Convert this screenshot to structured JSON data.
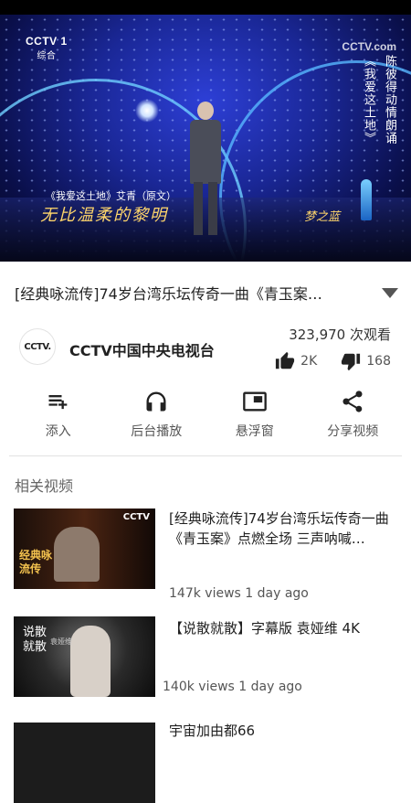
{
  "player": {
    "channel_logo": "CCTV 1",
    "channel_logo_sub": "综合",
    "watermark": "CCTV.com",
    "caption_title": "《我爱这土地》艾青（原文）",
    "caption_main": "无比温柔的黎明",
    "caption_right": "梦之蓝",
    "vertical_lines": [
      "陈彼得动情朗诵",
      "《我爱这土地》"
    ]
  },
  "video": {
    "title": "[经典咏流传]74岁台湾乐坛传奇一曲《青玉案…",
    "views": "323,970 次观看",
    "likes": "2K",
    "dislikes": "168"
  },
  "channel": {
    "avatar_text": "CCTV.",
    "name": "CCTV中国中央电视台"
  },
  "actions": [
    {
      "label": "添入",
      "icon": "playlist-add-icon"
    },
    {
      "label": "后台播放",
      "icon": "headphones-icon"
    },
    {
      "label": "悬浮窗",
      "icon": "picture-in-picture-icon"
    },
    {
      "label": "分享视频",
      "icon": "share-icon"
    }
  ],
  "related": {
    "heading": "相关视频",
    "items": [
      {
        "title": "[经典咏流传]74岁台湾乐坛传奇一曲《青玉案》点燃全场 三声呐喊…",
        "meta": "147k views 1 day ago",
        "thumb_logo": "CCTV",
        "thumb_text": "经典咏流传"
      },
      {
        "title": "【说散就散】字幕版 袁娅维 4K",
        "meta": "140k views 1 day ago",
        "thumb_text": "说散就散",
        "thumb_sub": "袁娅维"
      },
      {
        "title": "宇宙加由都66",
        "meta": ""
      }
    ]
  }
}
